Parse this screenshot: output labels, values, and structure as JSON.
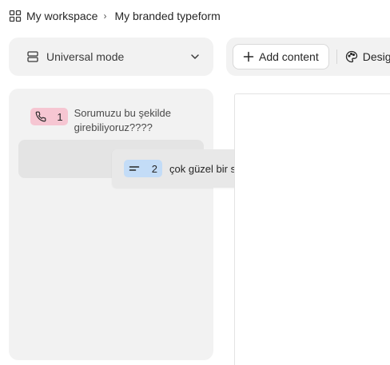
{
  "breadcrumb": {
    "workspace": "My workspace",
    "separator": "›",
    "form_name": "My branded typeform",
    "icon": "grid-icon"
  },
  "mode": {
    "label": "Universal mode",
    "icon": "layers-icon",
    "chevron": "chevron-down-icon"
  },
  "toolbar": {
    "add_content": "Add content",
    "design_label": "Design",
    "design_icon": "palette-icon"
  },
  "questions": [
    {
      "number": "1",
      "text": "Sorumuzu bu şekilde girebiliyoruz????",
      "type_icon": "phone-icon",
      "color": "#f6c6d2"
    },
    {
      "number": "2",
      "text": "çok güzel bir sistem",
      "type_icon": "short-text-icon",
      "color": "#c3dcf7"
    }
  ],
  "colors": {
    "panel_bg": "#f2f2f2",
    "phone_badge": "#f6c6d2",
    "text_badge": "#c3dcf7"
  }
}
